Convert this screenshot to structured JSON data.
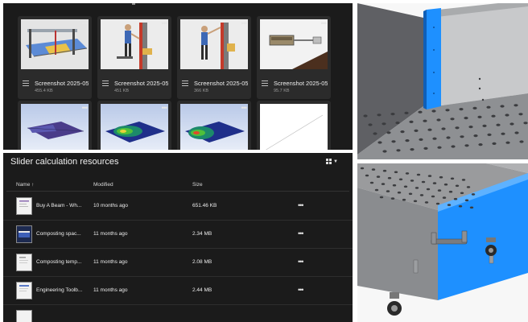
{
  "grid": {
    "cards": [
      {
        "name": "Screenshot 2025-05-...",
        "size": "455.4 KB",
        "thumb": "scaffold-render"
      },
      {
        "name": "Screenshot 2025-05-...",
        "size": "451 KB",
        "thumb": "person-lifting-render"
      },
      {
        "name": "Screenshot 2025-05-...",
        "size": "366 KB",
        "thumb": "person-reaching-render"
      },
      {
        "name": "Screenshot 2025-05-...",
        "size": "95.7 KB",
        "thumb": "mechanism-render"
      },
      {
        "thumb": "fea-plate-1"
      },
      {
        "thumb": "fea-plate-2"
      },
      {
        "thumb": "fea-plate-3"
      },
      {
        "thumb": "blank-plot"
      }
    ],
    "more_icon": "more-horizontal-icon",
    "file_icon": "file-lines-icon"
  },
  "list": {
    "title": "Slider calculation resources",
    "view_icon": "grid-view-icon",
    "columns": {
      "name": "Name",
      "sort_arrow": "↑",
      "modified": "Modified",
      "size": "Size"
    },
    "rows": [
      {
        "name": "Buy A Beam - Wh...",
        "modified": "10 months ago",
        "size": "651.46 KB"
      },
      {
        "name": "Composting spac...",
        "modified": "11 months ago",
        "size": "2.34 MB"
      },
      {
        "name": "Composting temp...",
        "modified": "11 months ago",
        "size": "2.08 MB"
      },
      {
        "name": "Engineering Toolb...",
        "modified": "11 months ago",
        "size": "2.44 MB"
      }
    ]
  },
  "colors": {
    "panel_bg": "#1b1b1b",
    "card_bg": "#2b2b2b",
    "cad_blue": "#1e90ff",
    "cad_metal": "#8e8e8e"
  }
}
